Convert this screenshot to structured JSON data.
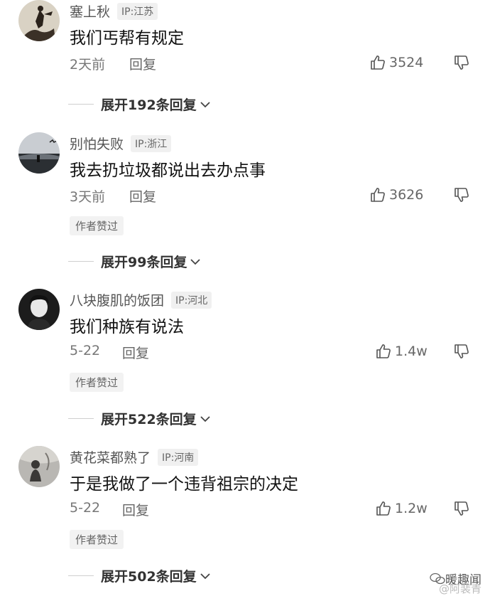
{
  "comments": [
    {
      "username": "塞上秋",
      "ip": "IP:江苏",
      "content": "我们丐帮有规定",
      "date": "2天前",
      "reply_label": "回复",
      "likes": "3524",
      "author_liked": "",
      "expand_label": "展开192条回复"
    },
    {
      "username": "别怕失败",
      "ip": "IP:浙江",
      "content": "我去扔垃圾都说出去办点事",
      "date": "3天前",
      "reply_label": "回复",
      "likes": "3626",
      "author_liked": "作者赞过",
      "expand_label": "展开99条回复"
    },
    {
      "username": "八块腹肌的饭团",
      "ip": "IP:河北",
      "content": "我们种族有说法",
      "date": "5-22",
      "reply_label": "回复",
      "likes": "1.4w",
      "author_liked": "作者赞过",
      "expand_label": "展开522条回复"
    },
    {
      "username": "黄花菜都熟了",
      "ip": "IP:河南",
      "content": "于是我做了一个违背祖宗的决定",
      "date": "5-22",
      "reply_label": "回复",
      "likes": "1.2w",
      "author_liked": "作者赞过",
      "expand_label": "展开502条回复"
    }
  ],
  "watermark": {
    "name": "暖趣闻",
    "sub": "@阿裴青"
  },
  "icons": {
    "like": "thumbs-up-icon",
    "dislike": "thumbs-down-icon",
    "expand": "chevron-down-icon"
  },
  "colors": {
    "text_primary": "#111111",
    "text_secondary": "#777777",
    "badge_bg": "#f0f0f0"
  }
}
